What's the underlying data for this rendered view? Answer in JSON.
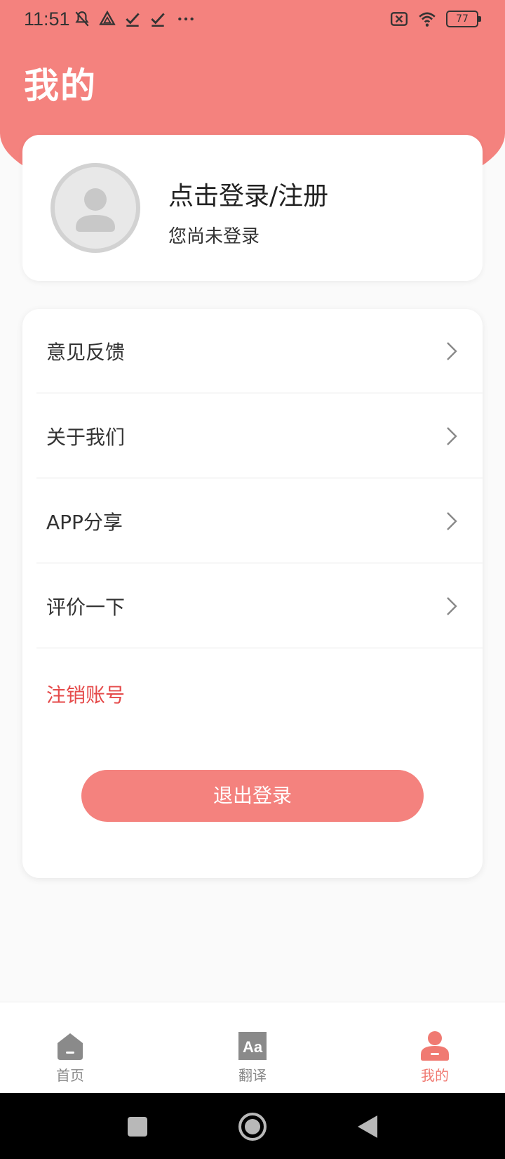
{
  "status_bar": {
    "time": "11:51",
    "battery": "77",
    "icons_left": [
      "mute-icon",
      "drive-icon",
      "check-icon",
      "check-icon",
      "more-dots-icon"
    ],
    "icons_right": [
      "sim-off-icon",
      "wifi-icon",
      "battery-icon"
    ]
  },
  "header": {
    "title": "我的",
    "bg_color": "#f4827e"
  },
  "profile": {
    "login_title": "点击登录/注册",
    "login_sub": "您尚未登录",
    "avatar_icon": "user-avatar-icon"
  },
  "menu": {
    "items": [
      {
        "label": "意见反馈"
      },
      {
        "label": "关于我们"
      },
      {
        "label": "APP分享"
      },
      {
        "label": "评价一下"
      }
    ],
    "cancel_account": "注销账号",
    "logout": "退出登录",
    "danger_color": "#e54a4a"
  },
  "tabbar": {
    "tabs": [
      {
        "label": "首页",
        "icon": "home-icon",
        "active": false
      },
      {
        "label": "翻译",
        "icon": "translate-icon",
        "active": false
      },
      {
        "label": "我的",
        "icon": "profile-icon",
        "active": true
      }
    ],
    "active_color": "#f07a72"
  },
  "navbar": {
    "buttons": [
      "recent-apps-icon",
      "home-circle-icon",
      "back-triangle-icon"
    ]
  }
}
